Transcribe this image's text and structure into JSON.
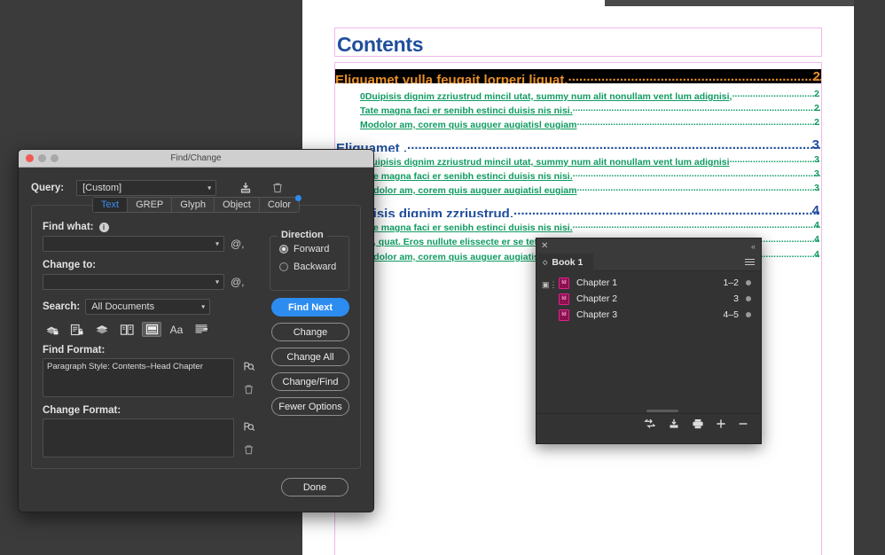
{
  "document": {
    "title": "Contents",
    "toc": [
      {
        "level": 1,
        "text": "Eliquamet vulla feugait lorperi liquat. ",
        "page": "2",
        "highlighted": true
      },
      {
        "level": 2,
        "text": "0Duipisis dignim zzriustrud mincil utat, summy num alit nonullam vent lum adignisi, ",
        "page": "2",
        "highlighted": false
      },
      {
        "level": 2,
        "text": "Tate magna faci er senibh estinci duisis nis nisi. ",
        "page": "2",
        "highlighted": false
      },
      {
        "level": 2,
        "text": "Modolor am, corem quis auguer augiatisl eugiam ",
        "page": "2",
        "highlighted": false
      },
      {
        "level": 1,
        "text": "Eliquamet . ",
        "page": "3",
        "highlighted": false
      },
      {
        "level": 2,
        "text": "0Duipisis dignim zzriustrud mincil utat, summy num alit nonullam vent lum adignisi",
        "page": "3",
        "highlighted": false
      },
      {
        "level": 2,
        "text": "Tate magna faci er senibh estinci duisis nis nisi. ",
        "page": "3",
        "highlighted": false
      },
      {
        "level": 2,
        "text": "Modolor am, corem quis auguer augiatisl eugiam ",
        "page": "3",
        "highlighted": false
      },
      {
        "level": 1,
        "text": "0Duipisis dignim zzriustrud.",
        "page": "4",
        "highlighted": false
      },
      {
        "level": 2,
        "text": "Tate magna faci er senibh estinci duisis nis nisi. ",
        "page": "4",
        "highlighted": false
      },
      {
        "level": 2,
        "text": "Tat, quat. Eros nullute elissecte er se tet at eriure ",
        "page": "4",
        "highlighted": false
      },
      {
        "level": 2,
        "text": "Modolor am, corem quis auguer augiatisl eugiam ",
        "page": "4",
        "highlighted": false
      }
    ],
    "colors": {
      "level1": "#1f4e9c",
      "level2": "#0f9b62",
      "highlight_bg": "#000000",
      "highlight_fg": "#e8902a",
      "frame_border": "#f0b9e8"
    }
  },
  "find_change": {
    "window_title": "Find/Change",
    "traffic_lights": [
      "close-button",
      "minimize-button",
      "zoom-button"
    ],
    "query": {
      "label": "Query:",
      "value": "[Custom]",
      "save_icon": "save-query-icon",
      "delete_icon": "delete-query-icon"
    },
    "tabs": [
      {
        "label": "Text",
        "active": true
      },
      {
        "label": "GREP",
        "active": false
      },
      {
        "label": "Glyph",
        "active": false
      },
      {
        "label": "Object",
        "active": false
      },
      {
        "label": "Color",
        "active": false,
        "badge": true
      }
    ],
    "find_what": {
      "label": "Find what:",
      "value": "",
      "placeholder": ""
    },
    "change_to": {
      "label": "Change to:",
      "value": "",
      "placeholder": ""
    },
    "search": {
      "label": "Search:",
      "value": "All Documents"
    },
    "direction": {
      "title": "Direction",
      "options": [
        {
          "label": "Forward",
          "selected": true
        },
        {
          "label": "Backward",
          "selected": false
        }
      ]
    },
    "option_icons": [
      {
        "name": "include-locked-layers-icon",
        "selected": false
      },
      {
        "name": "include-locked-stories-icon",
        "selected": false
      },
      {
        "name": "include-hidden-layers-icon",
        "selected": false
      },
      {
        "name": "include-master-pages-icon",
        "selected": false
      },
      {
        "name": "include-footnotes-icon",
        "selected": true
      },
      {
        "name": "case-sensitive-icon",
        "selected": false
      },
      {
        "name": "whole-word-icon",
        "selected": false
      }
    ],
    "find_format": {
      "label": "Find Format:",
      "value": "Paragraph Style: Contents–Head Chapter"
    },
    "change_format": {
      "label": "Change Format:",
      "value": ""
    },
    "buttons": [
      {
        "label": "Find Next",
        "primary": true
      },
      {
        "label": "Change",
        "primary": false
      },
      {
        "label": "Change All",
        "primary": false
      },
      {
        "label": "Change/Find",
        "primary": false
      },
      {
        "label": "Fewer Options",
        "primary": false
      }
    ],
    "done_button": "Done",
    "accent_color": "#2d8cf0"
  },
  "book_panel": {
    "tab_label": "Book 1",
    "close_icon": "close-icon",
    "collapse_icon": "collapse-panel-icon",
    "menu_icon": "panel-menu-icon",
    "rows": [
      {
        "name": "Chapter 1",
        "pages": "1–2"
      },
      {
        "name": "Chapter 2",
        "pages": "3"
      },
      {
        "name": "Chapter 3",
        "pages": "4–5"
      }
    ],
    "footer_icons": [
      "sync-book-icon",
      "save-book-icon",
      "print-book-icon",
      "add-document-icon",
      "remove-document-icon"
    ],
    "doc_icon_color": "#e0218a"
  }
}
